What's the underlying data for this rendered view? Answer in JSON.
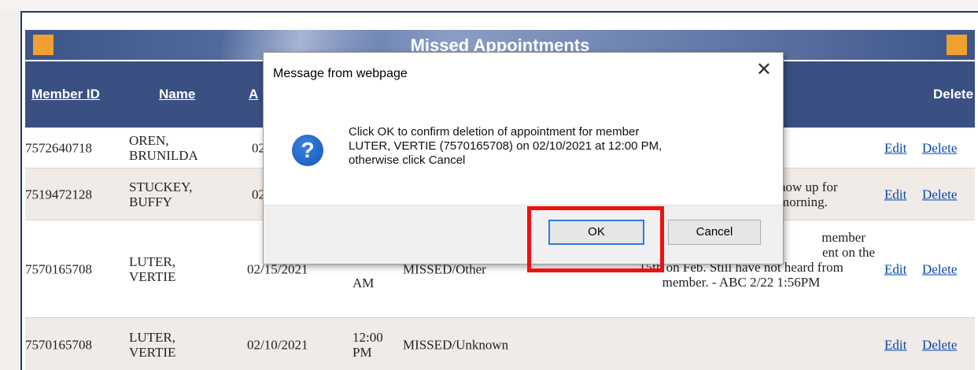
{
  "table": {
    "title": "Missed Appointments",
    "headers": {
      "member_id": "Member ID",
      "name": "Name",
      "appt_date": "A",
      "delete": "Delete"
    },
    "rows": [
      {
        "member_id": "7572640718",
        "name_last": "OREN,",
        "name_first": "BRUNILDA",
        "date": "02",
        "time_hr": "",
        "time_ampm": "",
        "status": "",
        "note_l1": "",
        "note_l2": "",
        "note_l3": "",
        "note_l4": "",
        "edit": "Edit",
        "delete": "Delete"
      },
      {
        "member_id": "7519472128",
        "name_last": "STUCKEY,",
        "name_first": "BUFFY",
        "date": "02",
        "time_hr": "",
        "time_ampm": "",
        "status": "",
        "note_l1": "how up for",
        "note_l2": "morning.",
        "note_l3": "",
        "note_l4": "",
        "edit": "Edit",
        "delete": "Delete"
      },
      {
        "member_id": "7570165708",
        "name_last": "LUTER,",
        "name_first": "VERTIE",
        "date": "02/15/2021",
        "time_hr": "",
        "time_ampm": "AM",
        "status": "MISSED/Other",
        "note_l1": "member",
        "note_l2": "ent on the",
        "note_l3": "15th on Feb. Still have not heard from",
        "note_l4": "member. - ABC 2/22 1:56PM",
        "edit": "Edit",
        "delete": "Delete"
      },
      {
        "member_id": "7570165708",
        "name_last": "LUTER,",
        "name_first": "VERTIE",
        "date": "02/10/2021",
        "time_hr": "12:00",
        "time_ampm": "PM",
        "status": "MISSED/Unknown",
        "note_l1": "",
        "note_l2": "",
        "note_l3": "",
        "note_l4": "",
        "edit": "Edit",
        "delete": "Delete"
      }
    ]
  },
  "dialog": {
    "title": "Message from webpage",
    "close_glyph": "✕",
    "icon": "question-icon",
    "icon_glyph": "?",
    "message_l1": "Click OK to confirm deletion of appointment for member",
    "message_l2": "LUTER, VERTIE (7570165708) on 02/10/2021 at 12:00 PM,",
    "message_l3": "otherwise click Cancel",
    "ok_label": "OK",
    "cancel_label": "Cancel"
  },
  "colors": {
    "header_bg": "#3a4f82",
    "accent_square": "#f0a030",
    "link": "#0645ad",
    "highlight": "#ee1111"
  }
}
